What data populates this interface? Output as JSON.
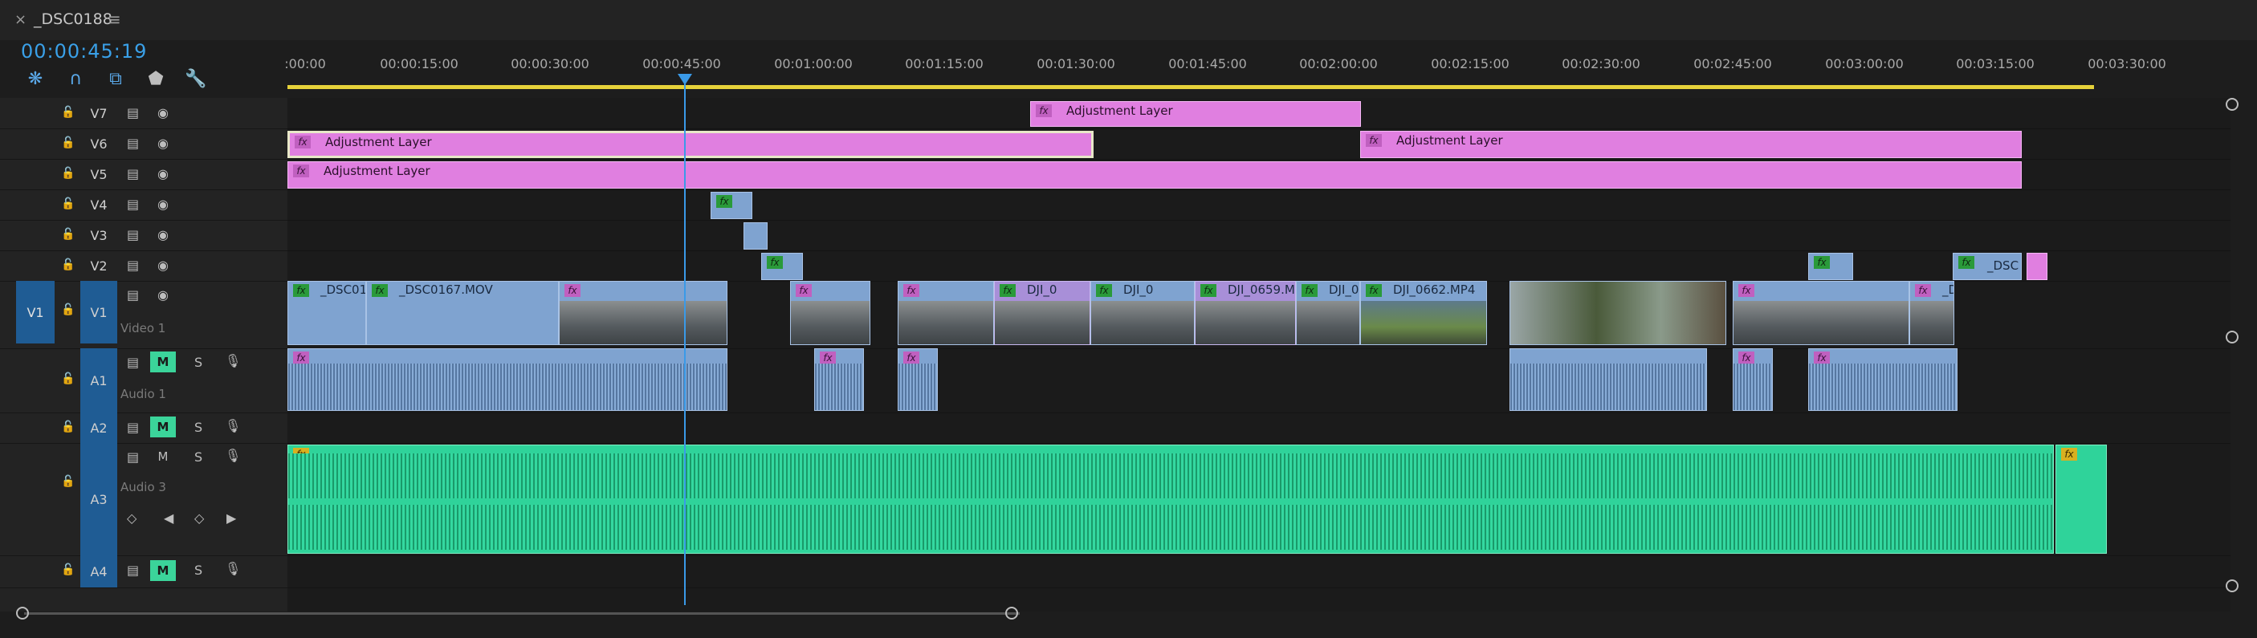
{
  "tab": {
    "title": "_DSC0188",
    "close_icon": "×",
    "menu_icon": "≡"
  },
  "timecode": "00:00:45:19",
  "tools": [
    "snap-icon",
    "magnet-icon",
    "linked-select-icon",
    "marker-icon",
    "wrench-icon"
  ],
  "ruler": {
    "labels": [
      ":00:00",
      "00:00:15:00",
      "00:00:30:00",
      "00:00:45:00",
      "00:01:00:00",
      "00:01:15:00",
      "00:01:30:00",
      "00:01:45:00",
      "00:02:00:00",
      "00:02:15:00",
      "00:02:30:00",
      "00:02:45:00",
      "00:03:00:00",
      "00:03:15:00",
      "00:03:30:00"
    ]
  },
  "video_tracks": [
    {
      "id": "V7",
      "label": "V7"
    },
    {
      "id": "V6",
      "label": "V6"
    },
    {
      "id": "V5",
      "label": "V5"
    },
    {
      "id": "V4",
      "label": "V4"
    },
    {
      "id": "V3",
      "label": "V3"
    },
    {
      "id": "V2",
      "label": "V2"
    },
    {
      "id": "V1",
      "label": "V1",
      "source": "V1",
      "name": "Video 1"
    }
  ],
  "audio_tracks": [
    {
      "id": "A1",
      "label": "A1",
      "name": "Audio 1",
      "m": "M",
      "s": "S"
    },
    {
      "id": "A2",
      "label": "A2",
      "m": "M",
      "s": "S"
    },
    {
      "id": "A3",
      "label": "A3",
      "name": "Audio 3",
      "m": "M",
      "s": "S"
    },
    {
      "id": "A4",
      "label": "A4",
      "m": "M",
      "s": "S"
    }
  ],
  "clips": {
    "adjustment_label": "Adjustment Layer",
    "fx_label": "fx",
    "v1_names": [
      "_DSC01",
      "_DSC0167.MOV",
      "DJI_0",
      "DJI_0",
      "DJI_0659.M",
      "DJI_0",
      "DJI_0662.MP4",
      "_DSC"
    ],
    "v2_name": "_DSC"
  },
  "colors": {
    "accent": "#3a9ae8",
    "adjustment": "#e07fe0",
    "video_clip": "#7fa3d0",
    "audio_clip": "#2fd39a",
    "mute_active": "#3bd49a"
  }
}
